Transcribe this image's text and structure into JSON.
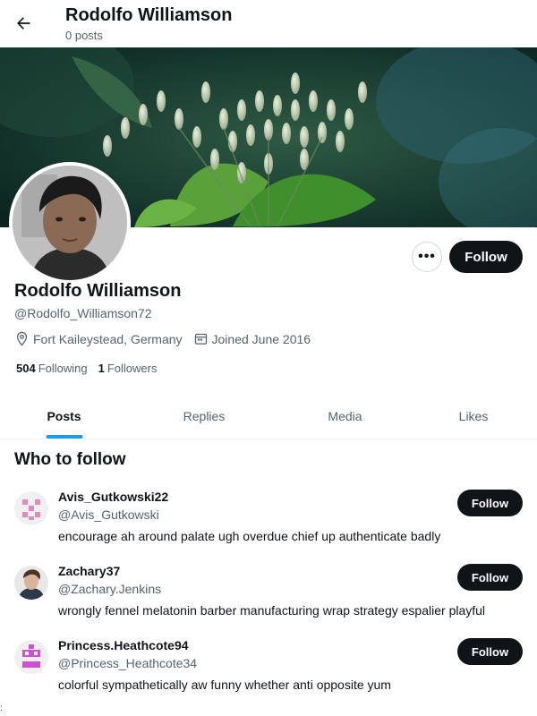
{
  "header": {
    "title": "Rodolfo Williamson",
    "subtitle": "0 posts"
  },
  "profile": {
    "name": "Rodolfo Williamson",
    "handle": "@Rodolfo_Williamson72",
    "location": "Fort Kaileystead, Germany",
    "joined": "Joined June 2016",
    "following_count": "504",
    "following_label": "Following",
    "followers_count": "1",
    "followers_label": "Followers",
    "follow_label": "Follow",
    "more_label": "•••"
  },
  "tabs": [
    {
      "label": "Posts",
      "active": true
    },
    {
      "label": "Replies",
      "active": false
    },
    {
      "label": "Media",
      "active": false
    },
    {
      "label": "Likes",
      "active": false
    }
  ],
  "who_to_follow": {
    "title": "Who to follow",
    "users": [
      {
        "name": "Avis_Gutkowski22",
        "handle": "@Avis_Gutkowski",
        "bio": "encourage ah around palate ugh overdue chief up authenticate badly",
        "follow_label": "Follow",
        "avatar": "identicon-pink-avatar"
      },
      {
        "name": "Zachary37",
        "handle": "@Zachary.Jenkins",
        "bio": "wrongly fennel melatonin barber manufacturing wrap strategy espalier playful",
        "follow_label": "Follow",
        "avatar": "photo-avatar"
      },
      {
        "name": "Princess.Heathcote94",
        "handle": "@Princess_Heathcote34",
        "bio": "colorful sympathetically aw funny whether anti opposite yum",
        "follow_label": "Follow",
        "avatar": "identicon-magenta-avatar"
      }
    ]
  },
  "edge_mark": ":",
  "colors": {
    "text_primary": "#0f1419",
    "text_secondary": "#536471",
    "accent": "#1d9bf0",
    "button_dark": "#0f1419",
    "border": "#cfd9de"
  }
}
